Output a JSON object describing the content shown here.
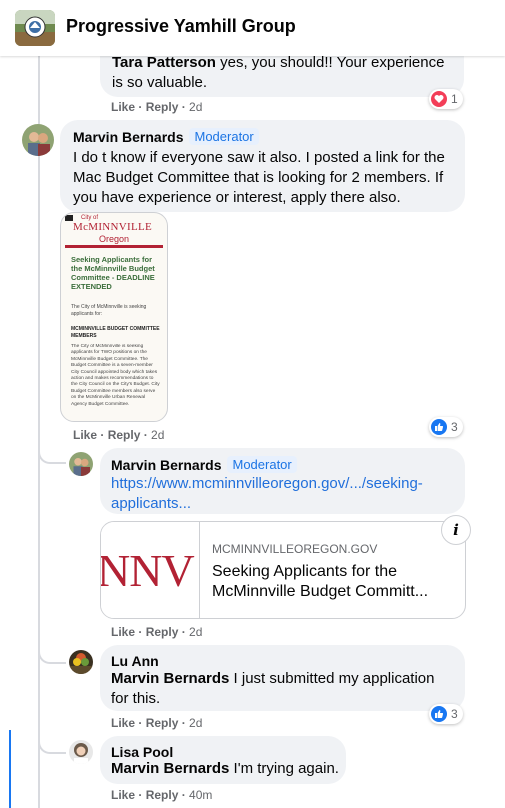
{
  "header": {
    "title": "Progressive Yamhill Group"
  },
  "comments": {
    "c0": {
      "text_name": "Tara Patterson",
      "text_body": "yes, you should!! Your experience is so valuable.",
      "like": "Like",
      "reply": "Reply",
      "time": "2d",
      "reaction_count": "1"
    },
    "c1": {
      "author": "Marvin Bernards",
      "badge": "Moderator",
      "text": "I do t know if everyone saw it also. I posted a link for the Mac Budget Committee that is looking for 2 members. If you have experience or interest, apply there also.",
      "like": "Like",
      "reply": "Reply",
      "time": "2d",
      "reaction_count": "3",
      "attachment": {
        "city_small": "City of",
        "city": "McMINNVILLE",
        "state": "Oregon",
        "headline": "Seeking Applicants for the McMinnville Budget Committee - DEADLINE EXTENDED",
        "intro": "The City of McMinnville is seeking applicants for:",
        "subhead": "MCMINNVILLE BUDGET COMMITTEE MEMBERS",
        "body": "The City of McMinnville is seeking applicants for TWO positions on the McMinnville Budget Committee. The Budget Committee is a seven-member City Council appointed body which takes action and makes recommendations to the City Council on the City's Budget. City Budget Committee members also serve on the McMinnville Urban Renewal Agency Budget Committee."
      }
    },
    "c2": {
      "author": "Marvin Bernards",
      "badge": "Moderator",
      "link_line1": "https://www.mcminnvilleoregon.gov/.../seeking-",
      "link_line2": "applicants...",
      "preview": {
        "domain": "MCMINNVILLEOREGON.GOV",
        "title_line1": "Seeking Applicants for the",
        "title_line2": "McMinnville Budget Committ...",
        "image_text": "NNV",
        "info": "i"
      },
      "like": "Like",
      "reply": "Reply",
      "time": "2d"
    },
    "c3": {
      "author": "Lu Ann",
      "mention": "Marvin Bernards",
      "text": "I just submitted my application for this.",
      "like": "Like",
      "reply": "Reply",
      "time": "2d",
      "reaction_count": "3"
    },
    "c4": {
      "author": "Lisa Pool",
      "mention": "Marvin Bernards",
      "text": "I'm trying again.",
      "like": "Like",
      "reply": "Reply",
      "time": "40m"
    }
  },
  "colors": {
    "accent_blue": "#1877f2",
    "link_blue": "#216fdb",
    "love_red": "#f33e58",
    "bubble_gray": "#f0f2f5",
    "doc_red": "#b22234"
  },
  "icons": {
    "like_reaction": "thumbs-up-icon",
    "love_reaction": "heart-icon",
    "info": "info-icon"
  }
}
